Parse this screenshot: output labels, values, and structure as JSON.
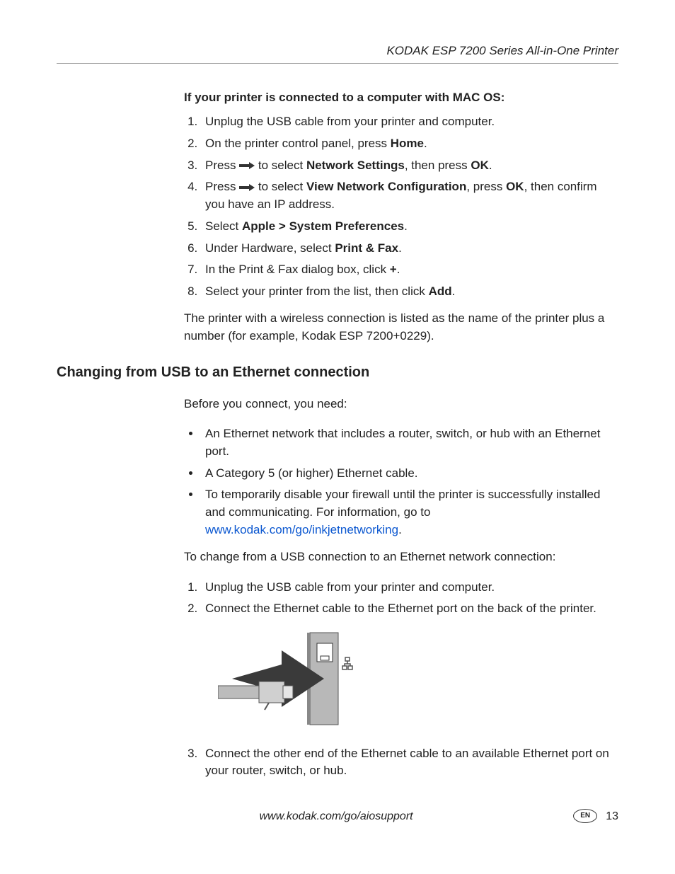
{
  "header": {
    "title": "KODAK ESP 7200 Series All-in-One Printer"
  },
  "section1": {
    "intro": "If your printer is connected to a computer with MAC OS:",
    "steps": {
      "s1": "Unplug the USB cable from your printer and computer.",
      "s2a": "On the printer control panel, press ",
      "s2b": "Home",
      "s2c": ".",
      "s3a": "Press ",
      "s3b": " to select ",
      "s3c": "Network Settings",
      "s3d": ", then press ",
      "s3e": "OK",
      "s3f": ".",
      "s4a": "Press ",
      "s4b": " to select ",
      "s4c": "View Network Configuration",
      "s4d": ", press ",
      "s4e": "OK",
      "s4f": ", then confirm you have an IP address.",
      "s5a": "Select ",
      "s5b": "Apple > System Preferences",
      "s5c": ".",
      "s6a": "Under Hardware, select ",
      "s6b": "Print & Fax",
      "s6c": ".",
      "s7a": "In the Print & Fax dialog box, click ",
      "s7b": "+",
      "s7c": ".",
      "s8a": "Select your printer from the list, then click ",
      "s8b": "Add",
      "s8c": "."
    },
    "footnote": "The printer with a wireless connection is listed as the name of the printer plus a number (for example, Kodak ESP 7200+0229)."
  },
  "section2": {
    "heading": "Changing from USB to an Ethernet connection",
    "intro": "Before you connect, you need:",
    "bullets": {
      "b1": "An Ethernet network that includes a router, switch, or hub with an Ethernet port.",
      "b2": "A Category 5 (or higher) Ethernet cable.",
      "b3a": "To temporarily disable your firewall until the printer is successfully installed and communicating. For information, go to ",
      "b3link": "www.kodak.com/go/inkjetnetworking",
      "b3b": "."
    },
    "para2": "To change from a USB connection to an Ethernet network connection:",
    "steps": {
      "s1": "Unplug the USB cable from your printer and computer.",
      "s2": "Connect the Ethernet cable to the Ethernet port on the back of the printer.",
      "s3": "Connect the other end of the Ethernet cable to an available Ethernet port on your router, switch, or hub."
    }
  },
  "footer": {
    "url": "www.kodak.com/go/aiosupport",
    "lang": "EN",
    "page": "13"
  }
}
